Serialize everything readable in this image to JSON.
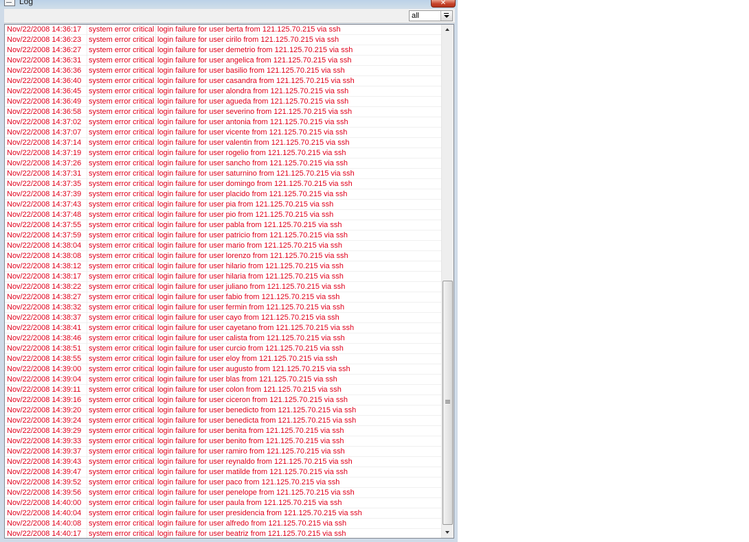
{
  "window": {
    "title": "Log",
    "close_label": "✕"
  },
  "filter": {
    "value": "all"
  },
  "colors": {
    "log_text": "#e0001b",
    "frame": "#cfdbe8"
  },
  "rows": [
    {
      "time": "Nov/22/2008 14:36:17",
      "level": "system error critical",
      "message": "login failure for user berta from 121.125.70.215 via ssh"
    },
    {
      "time": "Nov/22/2008 14:36:23",
      "level": "system error critical",
      "message": "login failure for user cirilo from 121.125.70.215 via ssh"
    },
    {
      "time": "Nov/22/2008 14:36:27",
      "level": "system error critical",
      "message": "login failure for user demetrio from 121.125.70.215 via ssh"
    },
    {
      "time": "Nov/22/2008 14:36:31",
      "level": "system error critical",
      "message": "login failure for user angelica from 121.125.70.215 via ssh"
    },
    {
      "time": "Nov/22/2008 14:36:36",
      "level": "system error critical",
      "message": "login failure for user basilio from 121.125.70.215 via ssh"
    },
    {
      "time": "Nov/22/2008 14:36:40",
      "level": "system error critical",
      "message": "login failure for user casandra from 121.125.70.215 via ssh"
    },
    {
      "time": "Nov/22/2008 14:36:45",
      "level": "system error critical",
      "message": "login failure for user alondra from 121.125.70.215 via ssh"
    },
    {
      "time": "Nov/22/2008 14:36:49",
      "level": "system error critical",
      "message": "login failure for user agueda from 121.125.70.215 via ssh"
    },
    {
      "time": "Nov/22/2008 14:36:58",
      "level": "system error critical",
      "message": "login failure for user severino from 121.125.70.215 via ssh"
    },
    {
      "time": "Nov/22/2008 14:37:02",
      "level": "system error critical",
      "message": "login failure for user antonia from 121.125.70.215 via ssh"
    },
    {
      "time": "Nov/22/2008 14:37:07",
      "level": "system error critical",
      "message": "login failure for user vicente from 121.125.70.215 via ssh"
    },
    {
      "time": "Nov/22/2008 14:37:14",
      "level": "system error critical",
      "message": "login failure for user valentin from 121.125.70.215 via ssh"
    },
    {
      "time": "Nov/22/2008 14:37:19",
      "level": "system error critical",
      "message": "login failure for user rogelio from 121.125.70.215 via ssh"
    },
    {
      "time": "Nov/22/2008 14:37:26",
      "level": "system error critical",
      "message": "login failure for user sancho from 121.125.70.215 via ssh"
    },
    {
      "time": "Nov/22/2008 14:37:31",
      "level": "system error critical",
      "message": "login failure for user saturnino from 121.125.70.215 via ssh"
    },
    {
      "time": "Nov/22/2008 14:37:35",
      "level": "system error critical",
      "message": "login failure for user domingo from 121.125.70.215 via ssh"
    },
    {
      "time": "Nov/22/2008 14:37:39",
      "level": "system error critical",
      "message": "login failure for user placido from 121.125.70.215 via ssh"
    },
    {
      "time": "Nov/22/2008 14:37:43",
      "level": "system error critical",
      "message": "login failure for user pia from 121.125.70.215 via ssh"
    },
    {
      "time": "Nov/22/2008 14:37:48",
      "level": "system error critical",
      "message": "login failure for user pio from 121.125.70.215 via ssh"
    },
    {
      "time": "Nov/22/2008 14:37:55",
      "level": "system error critical",
      "message": "login failure for user pabla from 121.125.70.215 via ssh"
    },
    {
      "time": "Nov/22/2008 14:37:59",
      "level": "system error critical",
      "message": "login failure for user patricio from 121.125.70.215 via ssh"
    },
    {
      "time": "Nov/22/2008 14:38:04",
      "level": "system error critical",
      "message": "login failure for user mario from 121.125.70.215 via ssh"
    },
    {
      "time": "Nov/22/2008 14:38:08",
      "level": "system error critical",
      "message": "login failure for user lorenzo from 121.125.70.215 via ssh"
    },
    {
      "time": "Nov/22/2008 14:38:12",
      "level": "system error critical",
      "message": "login failure for user hilario from 121.125.70.215 via ssh"
    },
    {
      "time": "Nov/22/2008 14:38:17",
      "level": "system error critical",
      "message": "login failure for user hilaria from 121.125.70.215 via ssh"
    },
    {
      "time": "Nov/22/2008 14:38:22",
      "level": "system error critical",
      "message": "login failure for user juliano from 121.125.70.215 via ssh"
    },
    {
      "time": "Nov/22/2008 14:38:27",
      "level": "system error critical",
      "message": "login failure for user fabio from 121.125.70.215 via ssh"
    },
    {
      "time": "Nov/22/2008 14:38:32",
      "level": "system error critical",
      "message": "login failure for user fermin from 121.125.70.215 via ssh"
    },
    {
      "time": "Nov/22/2008 14:38:37",
      "level": "system error critical",
      "message": "login failure for user cayo from 121.125.70.215 via ssh"
    },
    {
      "time": "Nov/22/2008 14:38:41",
      "level": "system error critical",
      "message": "login failure for user cayetano from 121.125.70.215 via ssh"
    },
    {
      "time": "Nov/22/2008 14:38:46",
      "level": "system error critical",
      "message": "login failure for user calista from 121.125.70.215 via ssh"
    },
    {
      "time": "Nov/22/2008 14:38:51",
      "level": "system error critical",
      "message": "login failure for user curcio from 121.125.70.215 via ssh"
    },
    {
      "time": "Nov/22/2008 14:38:55",
      "level": "system error critical",
      "message": "login failure for user eloy from 121.125.70.215 via ssh"
    },
    {
      "time": "Nov/22/2008 14:39:00",
      "level": "system error critical",
      "message": "login failure for user augusto from 121.125.70.215 via ssh"
    },
    {
      "time": "Nov/22/2008 14:39:04",
      "level": "system error critical",
      "message": "login failure for user blas from 121.125.70.215 via ssh"
    },
    {
      "time": "Nov/22/2008 14:39:11",
      "level": "system error critical",
      "message": "login failure for user colon from 121.125.70.215 via ssh"
    },
    {
      "time": "Nov/22/2008 14:39:16",
      "level": "system error critical",
      "message": "login failure for user ciceron from 121.125.70.215 via ssh"
    },
    {
      "time": "Nov/22/2008 14:39:20",
      "level": "system error critical",
      "message": "login failure for user benedicto from 121.125.70.215 via ssh"
    },
    {
      "time": "Nov/22/2008 14:39:24",
      "level": "system error critical",
      "message": "login failure for user benedicta from 121.125.70.215 via ssh"
    },
    {
      "time": "Nov/22/2008 14:39:29",
      "level": "system error critical",
      "message": "login failure for user benita from 121.125.70.215 via ssh"
    },
    {
      "time": "Nov/22/2008 14:39:33",
      "level": "system error critical",
      "message": "login failure for user benito from 121.125.70.215 via ssh"
    },
    {
      "time": "Nov/22/2008 14:39:37",
      "level": "system error critical",
      "message": "login failure for user ramiro from 121.125.70.215 via ssh"
    },
    {
      "time": "Nov/22/2008 14:39:43",
      "level": "system error critical",
      "message": "login failure for user reynaldo from 121.125.70.215 via ssh"
    },
    {
      "time": "Nov/22/2008 14:39:47",
      "level": "system error critical",
      "message": "login failure for user matilde from 121.125.70.215 via ssh"
    },
    {
      "time": "Nov/22/2008 14:39:52",
      "level": "system error critical",
      "message": "login failure for user paco from 121.125.70.215 via ssh"
    },
    {
      "time": "Nov/22/2008 14:39:56",
      "level": "system error critical",
      "message": "login failure for user penelope from 121.125.70.215 via ssh"
    },
    {
      "time": "Nov/22/2008 14:40:00",
      "level": "system error critical",
      "message": "login failure for user paula from 121.125.70.215 via ssh"
    },
    {
      "time": "Nov/22/2008 14:40:04",
      "level": "system error critical",
      "message": "login failure for user presidencia from 121.125.70.215 via ssh"
    },
    {
      "time": "Nov/22/2008 14:40:08",
      "level": "system error critical",
      "message": "login failure for user alfredo from 121.125.70.215 via ssh"
    },
    {
      "time": "Nov/22/2008 14:40:17",
      "level": "system error critical",
      "message": "login failure for user beatriz from 121.125.70.215 via ssh"
    }
  ]
}
